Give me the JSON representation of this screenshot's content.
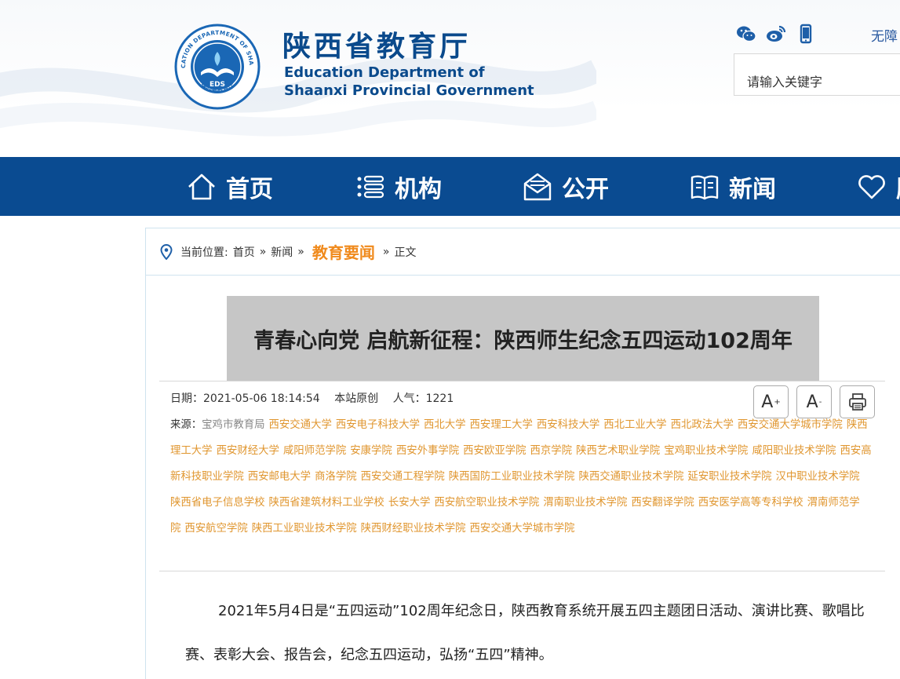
{
  "header": {
    "site_name_cn": "陕西省教育厅",
    "site_name_en_line1": "Education Department of",
    "site_name_en_line2": "Shaanxi Provincial Government",
    "logo_text_outer": "EDUCATION DEPARTMENT OF SHAANXI",
    "logo_text_inner": "EDS",
    "logo_text_bottom": "陕西省教育厅",
    "social_icons": [
      "wechat-icon",
      "weibo-icon",
      "mobile-icon"
    ],
    "access_link": "无障",
    "search_placeholder": "请输入关键字"
  },
  "nav": {
    "items": [
      {
        "label": "首页",
        "icon": "home-icon"
      },
      {
        "label": "机构",
        "icon": "list-icon"
      },
      {
        "label": "公开",
        "icon": "mail-icon"
      },
      {
        "label": "新闻",
        "icon": "book-icon"
      },
      {
        "label": "服",
        "icon": "heart-icon"
      }
    ]
  },
  "breadcrumb": {
    "prefix": "当前位置:",
    "home": "首页",
    "sep": "»",
    "news": "新闻",
    "current": "教育要闻",
    "leaf": "正文"
  },
  "article": {
    "title": "青春心向党 启航新征程：陕西师生纪念五四运动102周年",
    "date_label": "日期：",
    "date": "2021-05-06 18:14:54",
    "origin": "本站原创",
    "views_label": "人气：",
    "views": "1221",
    "font_larger": "A",
    "font_smaller": "A",
    "font_larger_sup": "+",
    "font_smaller_sup": "-",
    "source_label": "来源：",
    "source_origin": "宝鸡市教育局",
    "sources": [
      "西安交通大学",
      "西安电子科技大学",
      "西北大学",
      "西安理工大学",
      "西安科技大学",
      "西北工业大学",
      "西北政法大学",
      "西安交通大学城市学院",
      "陕西理工大学",
      "西安财经大学",
      "咸阳师范学院",
      "安康学院",
      "西安外事学院",
      "西安欧亚学院",
      "西京学院",
      "陕西艺术职业学院",
      "宝鸡职业技术学院",
      "咸阳职业技术学院",
      "西安高新科技职业学院",
      "西安邮电大学",
      "商洛学院",
      "西安交通工程学院",
      "陕西国防工业职业技术学院",
      "陕西交通职业技术学院",
      "延安职业技术学院",
      "汉中职业技术学院",
      "陕西省电子信息学校",
      "陕西省建筑材料工业学校",
      "长安大学",
      "西安航空职业技术学院",
      "渭南职业技术学院",
      "西安翻译学院",
      "西安医学高等专科学校",
      "渭南师范学院",
      "西安航空学院",
      "陕西工业职业技术学院",
      "陕西财经职业技术学院",
      "西安交通大学城市学院"
    ],
    "paragraph": "2021年5月4日是“五四运动”102周年纪念日，陕西教育系统开展五四主题团日活动、演讲比赛、歌唱比赛、表彰大会、报告会，纪念五四运动，弘扬“五四”精神。"
  },
  "colors": {
    "brand_blue": "#0a4b91",
    "accent_orange": "#f08a1c",
    "link_orange": "#e0962f"
  }
}
